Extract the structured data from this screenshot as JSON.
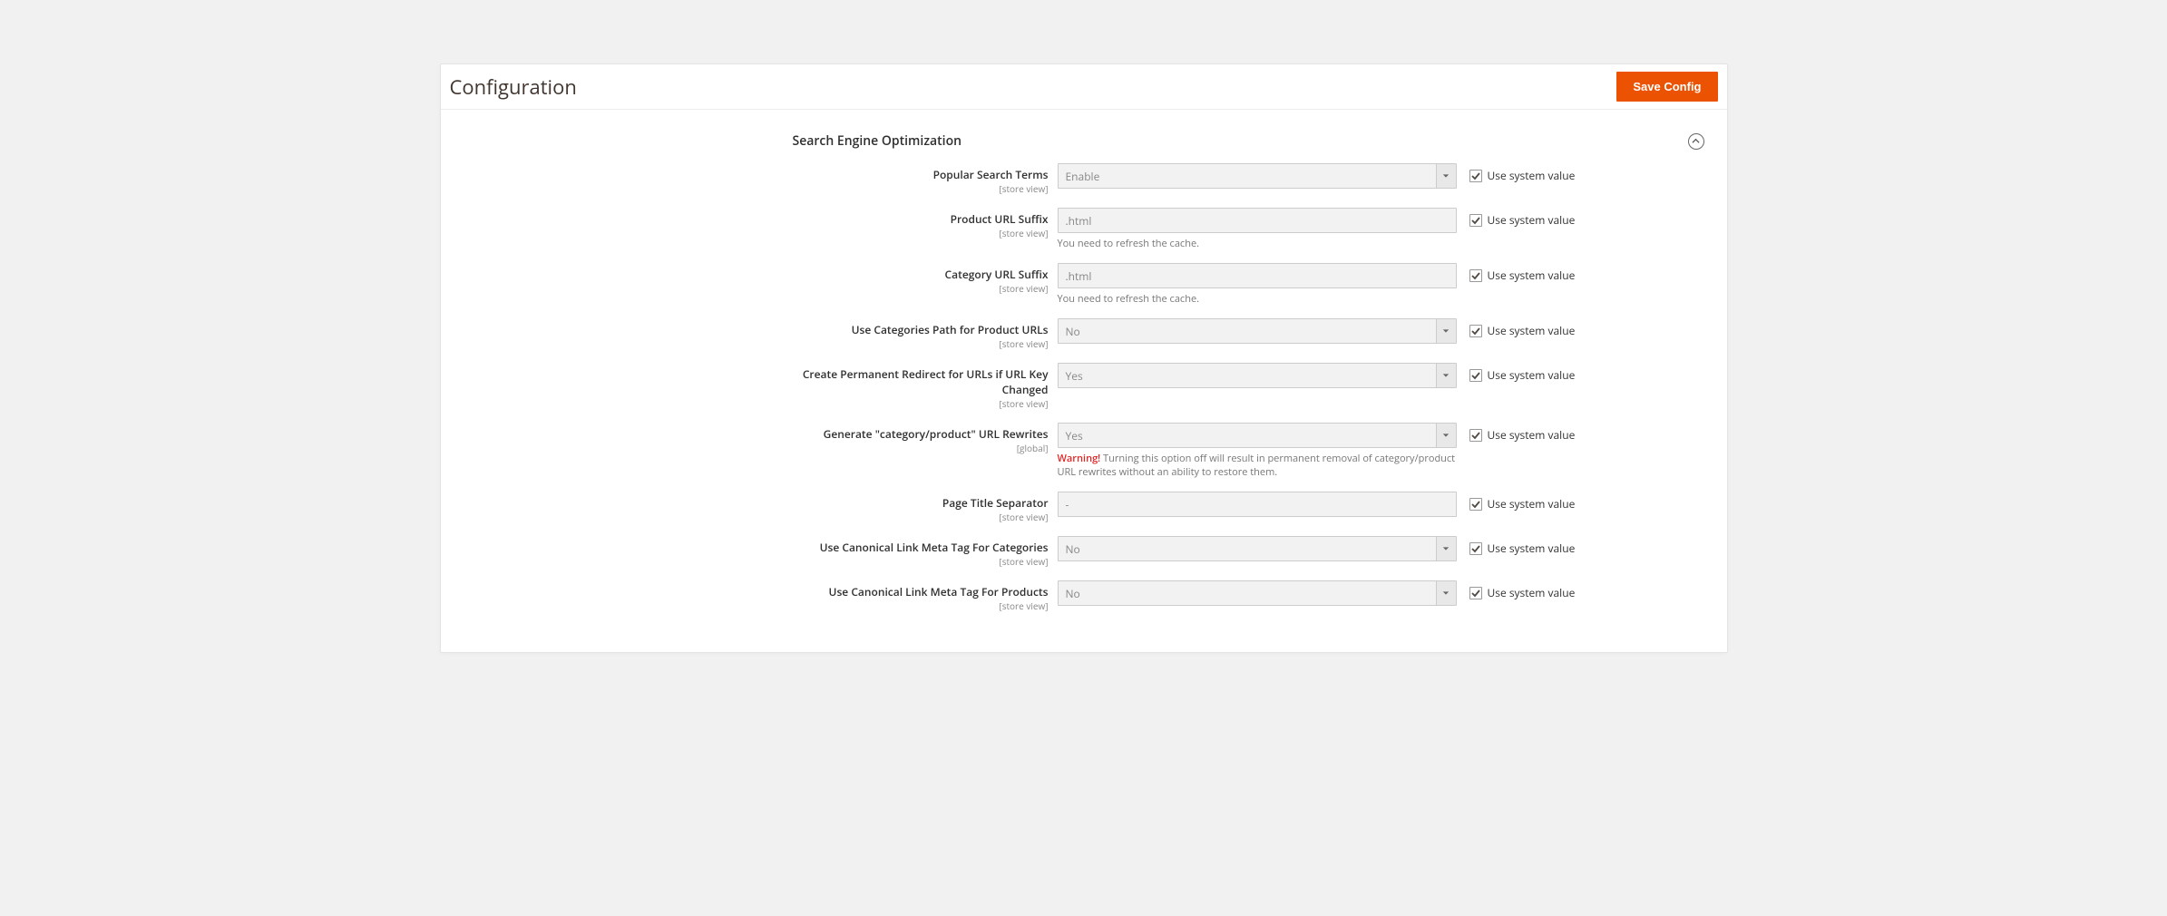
{
  "page_title": "Configuration",
  "save_label": "Save Config",
  "section_title": "Search Engine Optimization",
  "use_system_label": "Use system value",
  "fields": {
    "popular_search": {
      "label": "Popular Search Terms",
      "scope": "[store view]",
      "value": "Enable",
      "type": "select"
    },
    "product_suffix": {
      "label": "Product URL Suffix",
      "scope": "[store view]",
      "value": ".html",
      "type": "input",
      "note": "You need to refresh the cache."
    },
    "category_suffix": {
      "label": "Category URL Suffix",
      "scope": "[store view]",
      "value": ".html",
      "type": "input",
      "note": "You need to refresh the cache."
    },
    "cat_path": {
      "label": "Use Categories Path for Product URLs",
      "scope": "[store view]",
      "value": "No",
      "type": "select"
    },
    "perm_redirect": {
      "label": "Create Permanent Redirect for URLs if URL Key Changed",
      "scope": "[store view]",
      "value": "Yes",
      "type": "select"
    },
    "gen_rewrites": {
      "label": "Generate \"category/product\" URL Rewrites",
      "scope": "[global]",
      "value": "Yes",
      "type": "select",
      "warn": "Warning!",
      "note": " Turning this option off will result in permanent removal of category/product URL rewrites without an ability to restore them."
    },
    "title_sep": {
      "label": "Page Title Separator",
      "scope": "[store view]",
      "value": "-",
      "type": "input"
    },
    "canon_cat": {
      "label": "Use Canonical Link Meta Tag For Categories",
      "scope": "[store view]",
      "value": "No",
      "type": "select"
    },
    "canon_prod": {
      "label": "Use Canonical Link Meta Tag For Products",
      "scope": "[store view]",
      "value": "No",
      "type": "select"
    }
  }
}
